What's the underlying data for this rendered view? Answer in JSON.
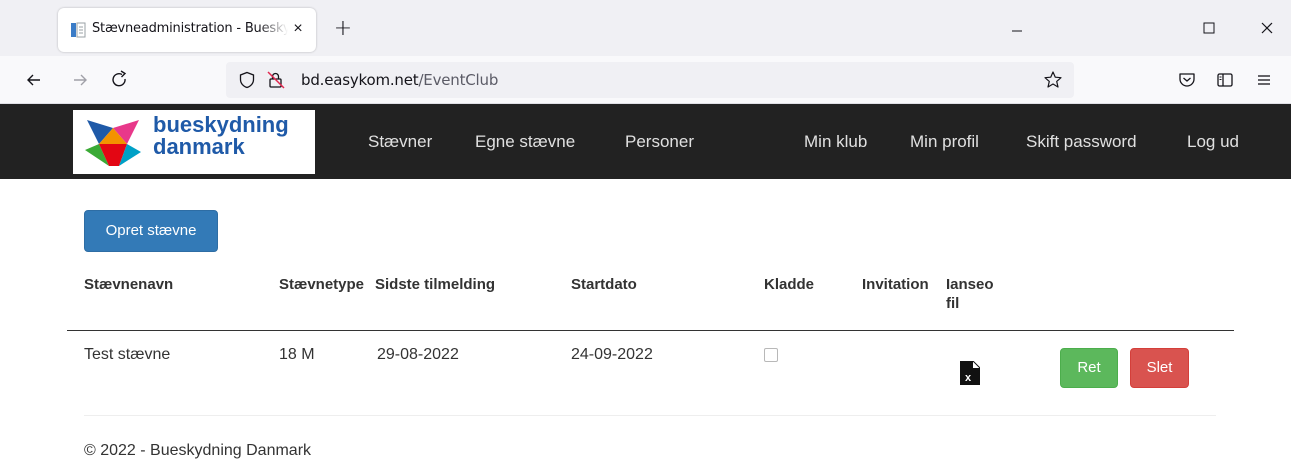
{
  "browser": {
    "tab_title": "Stævneadministration - Bueskydning Danmark",
    "tab_close": "×",
    "new_tab": "+",
    "url_domain": "bd.easykom.net",
    "url_path": "/EventClub"
  },
  "site": {
    "logo_line1": "bueskydning",
    "logo_line2": "danmark",
    "menu": {
      "staevner": "Stævner",
      "egne": "Egne stævne",
      "personer": "Personer",
      "minklub": "Min klub",
      "minprofil": "Min profil",
      "skift": "Skift password",
      "logud": "Log ud"
    }
  },
  "main": {
    "create_button": "Opret stævne",
    "columns": {
      "name": "Stævnenavn",
      "type": "Stævnetype",
      "deadline": "Sidste tilmelding",
      "start": "Startdato",
      "draft": "Kladde",
      "invitation": "Invitation",
      "ianseo_1": "Ianseo",
      "ianseo_2": "fil"
    },
    "rows": [
      {
        "name": "Test stævne",
        "type": "18 M",
        "deadline": "29-08-2022",
        "start": "24-09-2022",
        "draft": false,
        "ret": "Ret",
        "slet": "Slet"
      }
    ]
  },
  "footer": {
    "copyright": "© 2022 - Bueskydning Danmark"
  }
}
